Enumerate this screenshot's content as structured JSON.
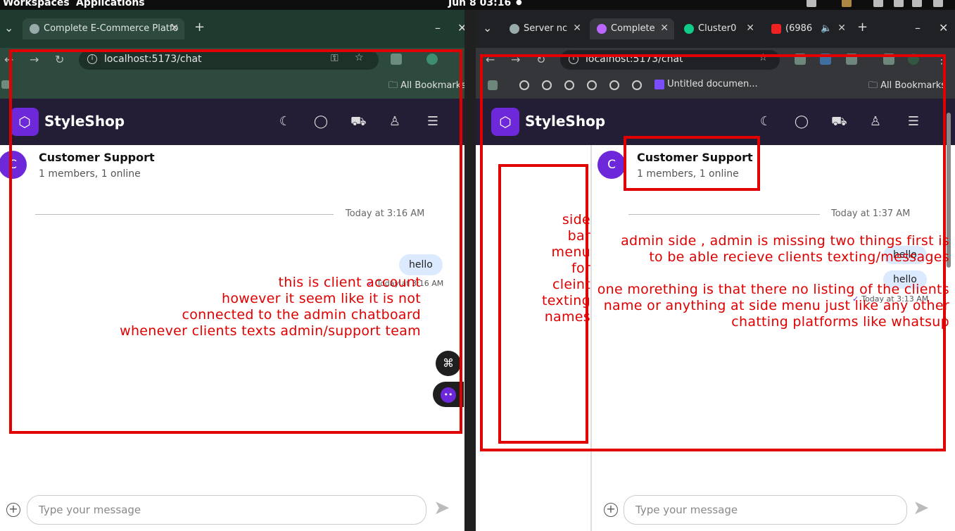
{
  "os_bar": {
    "workspaces": "Workspaces",
    "applications": "Applications",
    "datetime": "Jun 8  03:16",
    "dot": "●"
  },
  "left_window": {
    "tab_title": "Complete E-Commerce Platfo",
    "url": "localhost:5173/chat",
    "all_bookmarks": "All Bookmarks"
  },
  "right_window": {
    "tabs": [
      {
        "title": "Server nc"
      },
      {
        "title": "Complete"
      },
      {
        "title": "Cluster0"
      },
      {
        "title": "(6986"
      }
    ],
    "url": "localhost:5173/chat",
    "untitled_doc": "Untitled documen...",
    "all_bookmarks": "All Bookmarks"
  },
  "app": {
    "brand": "StyleShop",
    "theme_icon": "moon-icon",
    "chat_icon": "chat-bubble-icon",
    "cart_icon": "cart-icon",
    "user_icon": "user-icon",
    "menu_icon": "hamburger-icon"
  },
  "client_chat": {
    "avatar_letter": "C",
    "title": "Customer Support",
    "subtitle": "1 members, 1 online",
    "date_separator": "Today at 3:16 AM",
    "messages": [
      {
        "text": "hello",
        "time": "Today at 3:16 AM"
      }
    ],
    "input_placeholder": "Type your message"
  },
  "admin_chat": {
    "avatar_letter": "C",
    "title": "Customer Support",
    "subtitle": "1 members, 1 online",
    "date_separator": "Today at 1:37 AM",
    "messages": [
      {
        "text": "hello"
      },
      {
        "text": "hello",
        "time": "Today at 3:13 AM"
      }
    ],
    "input_placeholder": "Type your message"
  },
  "annotations": {
    "client_note": [
      "this is client account",
      "however it seem like it is not",
      "connected to the admin chatboard",
      "whenever clients texts admin/support team"
    ],
    "sidebar_note": [
      "side",
      "bar",
      "menu",
      "for",
      "cleint",
      "texting",
      "names"
    ],
    "admin_note": [
      "admin side , admin is missing two things first is",
      "to be able  recieve clients texting/messages",
      "",
      "one morething is that there no listing of the clients",
      "name or anything at side menu just like any other",
      "chatting platforms like whatsup"
    ]
  },
  "colors": {
    "annotation_red": "#e00000",
    "brand_purple": "#6d28d9",
    "header_dark": "#231d36"
  }
}
